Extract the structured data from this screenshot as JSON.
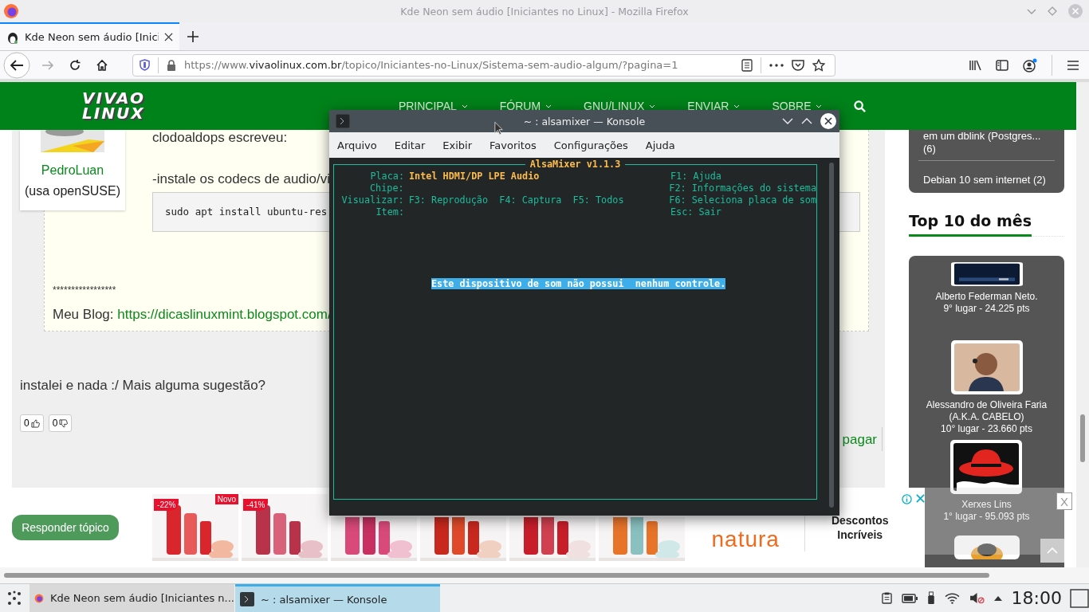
{
  "window": {
    "title": "Kde Neon sem áudio [Iniciantes no Linux] - Mozilla Firefox"
  },
  "tabs": [
    {
      "label": "Kde Neon sem áudio [Inici",
      "selected": true
    }
  ],
  "address_bar": {
    "prefix": "https://www.",
    "domain": "vivaolinux.com.br",
    "path": "/topico/Iniciantes-no-Linux/Sistema-sem-audio-algum/?pagina=1"
  },
  "site": {
    "logo_top": "VIVAO",
    "logo_bottom": "LINUX",
    "nav": [
      {
        "label": "PRINCIPAL"
      },
      {
        "label": "FÓRUM"
      },
      {
        "label": "GNU/LINUX"
      },
      {
        "label": "ENVIAR"
      },
      {
        "label": "SOBRE"
      }
    ]
  },
  "post": {
    "author": "PedroLuan",
    "distro": "(usa openSUSE)",
    "quote_author": "clodoaldops escreveu:",
    "quote_text": "-instale os codecs de audio/vi",
    "code": "sudo apt install ubuntu-res",
    "stars": "*****************",
    "blog_label": "Meu Blog:",
    "blog_link": "https://dicaslinuxmint.blogspot.com/"
  },
  "reply": {
    "text": "instalei e nada :/ Mais alguma sugestão?",
    "likes": "0",
    "dislikes": "0",
    "action": "pagar"
  },
  "sidebar": {
    "topics": [
      "em um dblink (Postgres... (6)",
      "Debian 10 sem internet (2)"
    ],
    "heading": "Top 10 do mês",
    "ranking": [
      {
        "name": "Alberto Federman Neto.",
        "score": "9° lugar - 24.225 pts"
      },
      {
        "name": "Alessandro de Oliveira Faria (A.K.A. CABELO)",
        "score": "10° lugar - 23.660 pts"
      },
      {
        "name": "Xerxes Lins",
        "score": "1° lugar - 95.093 pts"
      }
    ]
  },
  "ad": {
    "reply_button": "Responder tópico",
    "products": [
      {
        "kind": "picture",
        "badge": "-22%",
        "tag": "Novo"
      },
      {
        "kind": "picture",
        "badge": "-41%"
      },
      {
        "kind": "picture"
      },
      {
        "kind": "picture"
      },
      {
        "kind": "picture"
      },
      {
        "kind": "picture"
      }
    ],
    "brand": "natura",
    "headline": "Descontos Incríveis",
    "close": "X"
  },
  "konsole": {
    "title": "~ : alsamixer — Konsole",
    "menu": [
      "Arquivo",
      "Editar",
      "Exibir",
      "Favoritos",
      "Configurações",
      "Ajuda"
    ],
    "frame_title": "AlsaMixer v1.1.3",
    "rows": [
      {
        "label": "Placa:",
        "value": "Intel HDMI/DP LPE Audio",
        "key": "F1: Ajuda"
      },
      {
        "label": "Chipe:",
        "key": "F2: Informações do sistema"
      },
      {
        "label": "Visualizar:",
        "value": "F3: Reprodução  F4: Captura  F5: Todos",
        "key": "F6: Seleciona placa de som"
      },
      {
        "label": "Item:",
        "key": "Esc: Sair"
      }
    ],
    "message": "Este dispositivo de som não possui  nenhum controle."
  },
  "taskbar": {
    "tasks": [
      {
        "label": "Kde Neon sem áudio [Iniciantes n...",
        "kind": "browser",
        "selected": false
      },
      {
        "label": "~ : alsamixer — Konsole",
        "kind": "terminal",
        "selected": true
      }
    ],
    "clock": "18:00"
  }
}
